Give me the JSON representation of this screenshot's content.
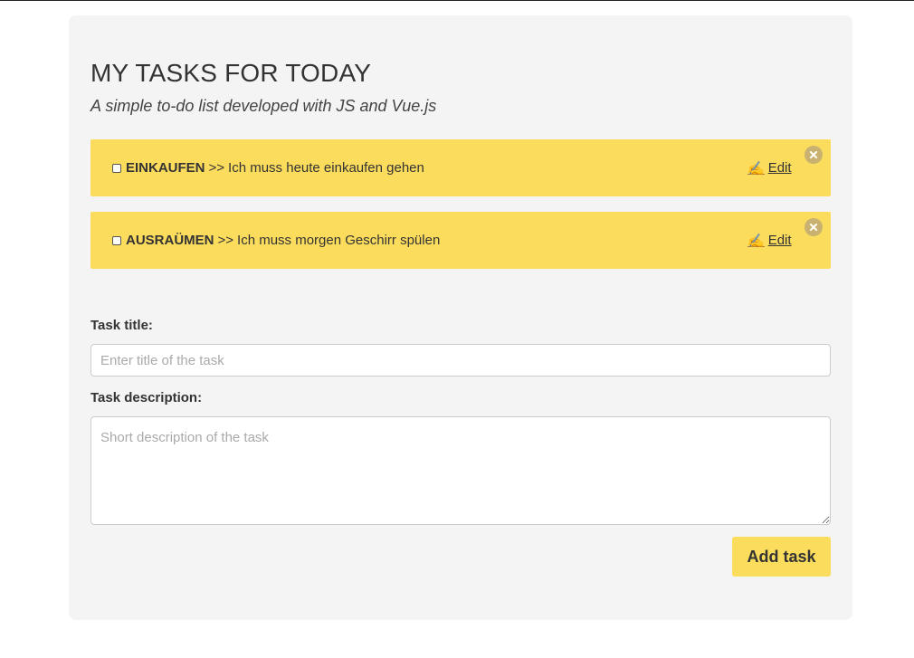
{
  "header": {
    "title": "MY TASKS FOR TODAY",
    "subtitle": "A simple to-do list developed with JS and Vue.js"
  },
  "tasks": [
    {
      "title": "EINKAUFEN",
      "separator": ">>",
      "description": "Ich muss heute einkaufen gehen",
      "edit_label": "Edit",
      "edit_icon": "✍",
      "checked": false
    },
    {
      "title": "AUSRAÜMEN",
      "separator": ">>",
      "description": "Ich muss morgen Geschirr spülen",
      "edit_label": "Edit",
      "edit_icon": "✍",
      "checked": false
    }
  ],
  "form": {
    "title_label": "Task title:",
    "title_placeholder": "Enter title of the task",
    "title_value": "",
    "description_label": "Task description:",
    "description_placeholder": "Short description of the task",
    "description_value": "",
    "submit_label": "Add task"
  },
  "colors": {
    "accent": "#fcdc5c",
    "card_background": "#f4f4f4",
    "delete_badge": "#c9b270",
    "text": "#333333"
  },
  "icons": {
    "edit": "writing-hand-icon",
    "delete": "close-circle-icon"
  }
}
